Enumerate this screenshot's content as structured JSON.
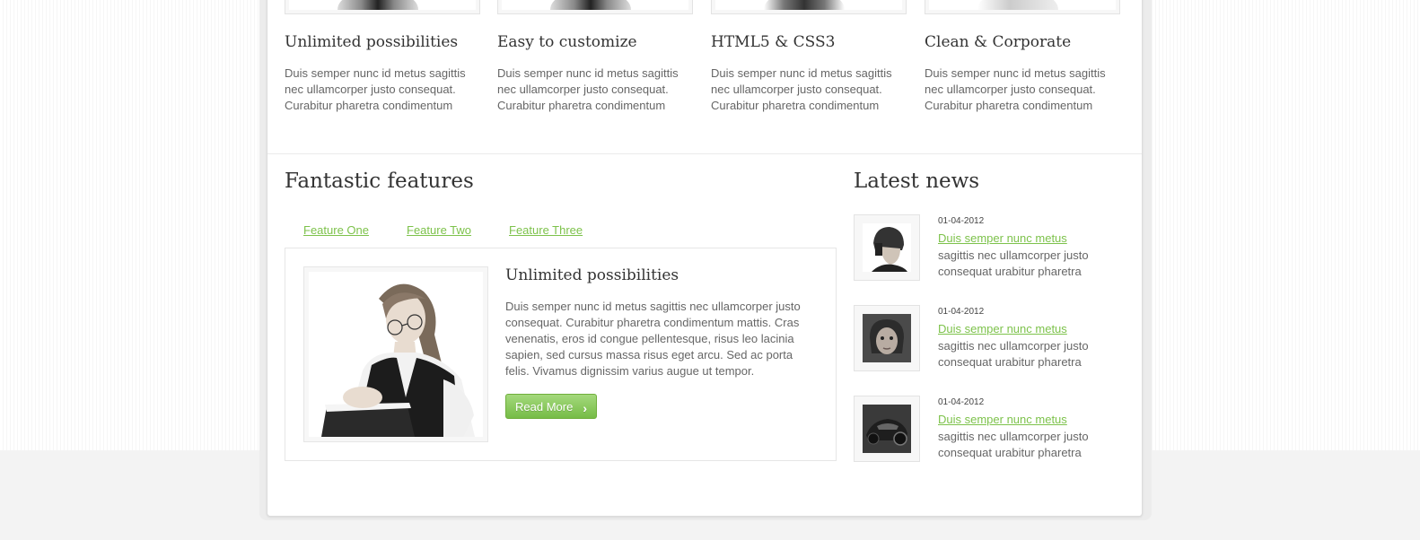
{
  "columns": [
    {
      "title": "Unlimited possibilities",
      "text": "Duis semper nunc id metus sagittis nec ullamcorper justo consequat. Curabitur pharetra condimentum"
    },
    {
      "title": "Easy to customize",
      "text": "Duis semper nunc id metus sagittis nec ullamcorper justo consequat. Curabitur pharetra condimentum"
    },
    {
      "title": "HTML5 & CSS3",
      "text": "Duis semper nunc id metus sagittis nec ullamcorper justo consequat. Curabitur pharetra condimentum"
    },
    {
      "title": "Clean & Corporate",
      "text": "Duis semper nunc id metus sagittis nec ullamcorper justo consequat. Curabitur pharetra condimentum"
    }
  ],
  "features": {
    "title": "Fantastic features",
    "tabs": [
      "Feature One",
      "Feature Two",
      "Feature Three"
    ],
    "active": {
      "title": "Unlimited possibilities",
      "text": "Duis semper nunc id metus sagittis nec ullamcorper justo consequat. Curabitur pharetra condimentum mattis. Cras venenatis, eros id congue pellentesque, risus leo lacinia sapien, sed cursus massa risus eget arcu. Sed ac porta felis. Vivamus dignissim varius augue ut tempor.",
      "button": "Read More",
      "button_icon": "chevron-right-icon"
    }
  },
  "news": {
    "title": "Latest news",
    "items": [
      {
        "date": "01-04-2012",
        "link": "Duis semper nunc metus",
        "text": "sagittis nec ullamcorper justo consequat urabitur pharetra"
      },
      {
        "date": "01-04-2012",
        "link": "Duis semper nunc metus",
        "text": "sagittis nec ullamcorper justo consequat urabitur pharetra"
      },
      {
        "date": "01-04-2012",
        "link": "Duis semper nunc metus",
        "text": "sagittis nec ullamcorper justo consequat urabitur pharetra"
      }
    ]
  },
  "colors": {
    "accent": "#7dc24b",
    "button_top": "#a4d97c",
    "button_bottom": "#76bc47",
    "heading": "#333333",
    "body_text": "#666666"
  }
}
